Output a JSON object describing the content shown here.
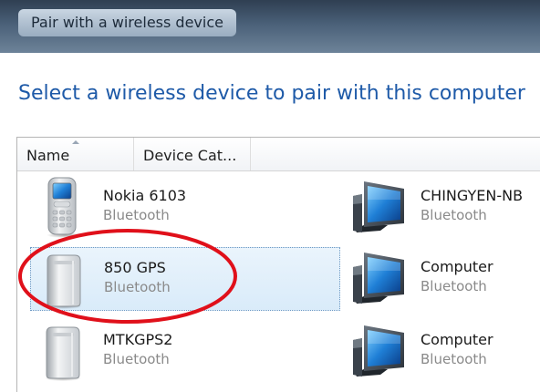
{
  "window": {
    "title": "Pair with a wireless device"
  },
  "heading": "Select a wireless device to pair with this computer",
  "columns": [
    {
      "label": "Name",
      "sorted": "ascending"
    },
    {
      "label": "Device Cat..."
    }
  ],
  "devices": [
    {
      "name": "Nokia 6103",
      "type": "Bluetooth",
      "icon": "mobile-phone-icon",
      "selected": false
    },
    {
      "name": "CHINGYEN-NB",
      "type": "Bluetooth",
      "icon": "computer-icon",
      "selected": false
    },
    {
      "name": "850 GPS",
      "type": "Bluetooth",
      "icon": "gps-device-icon",
      "selected": true
    },
    {
      "name": "Computer",
      "type": "Bluetooth",
      "icon": "computer-icon",
      "selected": false
    },
    {
      "name": "MTKGPS2",
      "type": "Bluetooth",
      "icon": "gps-device-icon",
      "selected": false
    },
    {
      "name": "Computer",
      "type": "Bluetooth",
      "icon": "computer-icon",
      "selected": false
    }
  ],
  "colors": {
    "heading": "#1e5aa8",
    "selection_background": "#dcecfa",
    "annotation_circle": "#e0101a"
  }
}
